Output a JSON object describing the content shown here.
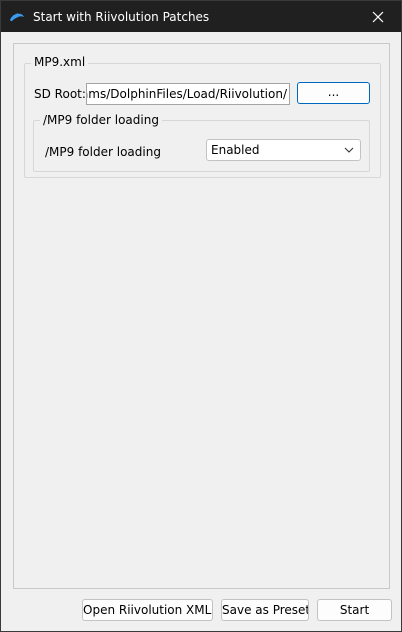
{
  "window": {
    "title": "Start with Riivolution Patches",
    "app_icon": "dolphin-icon",
    "close_icon": "close-icon"
  },
  "group": {
    "title": "MP9.xml",
    "sd_root": {
      "label": "SD Root:",
      "value": "C:/Users/Programs/DolphinFiles/Load/Riivolution/",
      "browse_label": "..."
    },
    "subgroup": {
      "title": "/MP9 folder loading",
      "option_label": "/MP9 folder loading",
      "selected": "Enabled"
    }
  },
  "buttons": {
    "open_xml": "Open Riivolution XML...",
    "save_preset": "Save as Preset...",
    "start": "Start"
  },
  "colors": {
    "titlebar_bg": "#202020",
    "window_bg": "#f0f0f0",
    "accent": "#0067c0"
  }
}
